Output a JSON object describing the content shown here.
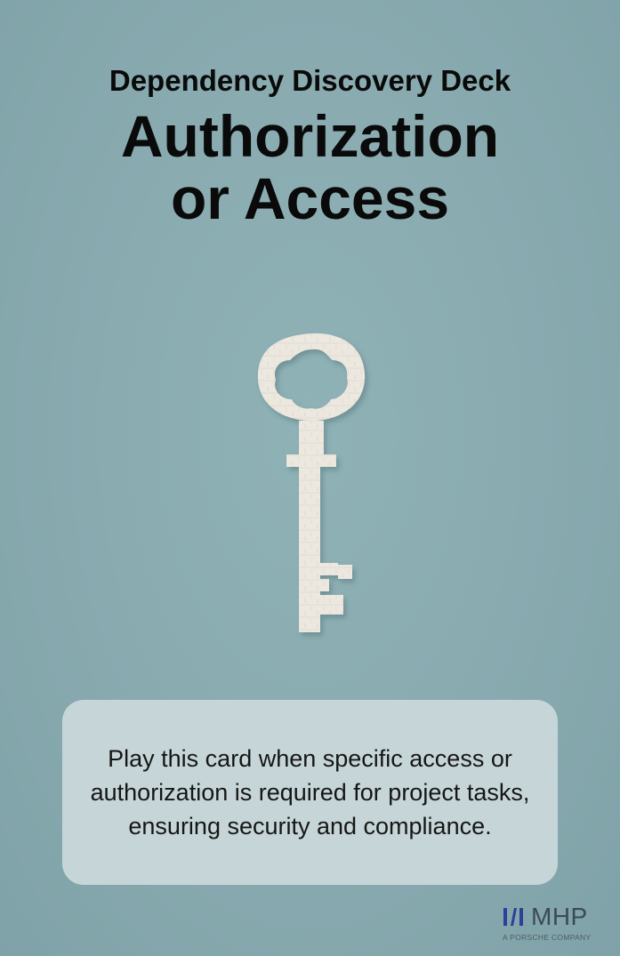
{
  "header": {
    "deck_title": "Dependency Discovery Deck",
    "card_title_line1": "Authorization",
    "card_title_line2": "or Access"
  },
  "illustration": {
    "icon": "key-icon"
  },
  "description": {
    "text": "Play this card when specific access or authorization is required for project tasks, ensuring security and compliance."
  },
  "brand": {
    "name": "MHP",
    "tagline": "A PORSCHE COMPANY",
    "colors": {
      "mark": "#2f3f9a",
      "text": "#3b4a5a"
    }
  },
  "colors": {
    "background": "#8aacb1",
    "description_box": "#c6d6d8",
    "key": "#ece8e0"
  }
}
